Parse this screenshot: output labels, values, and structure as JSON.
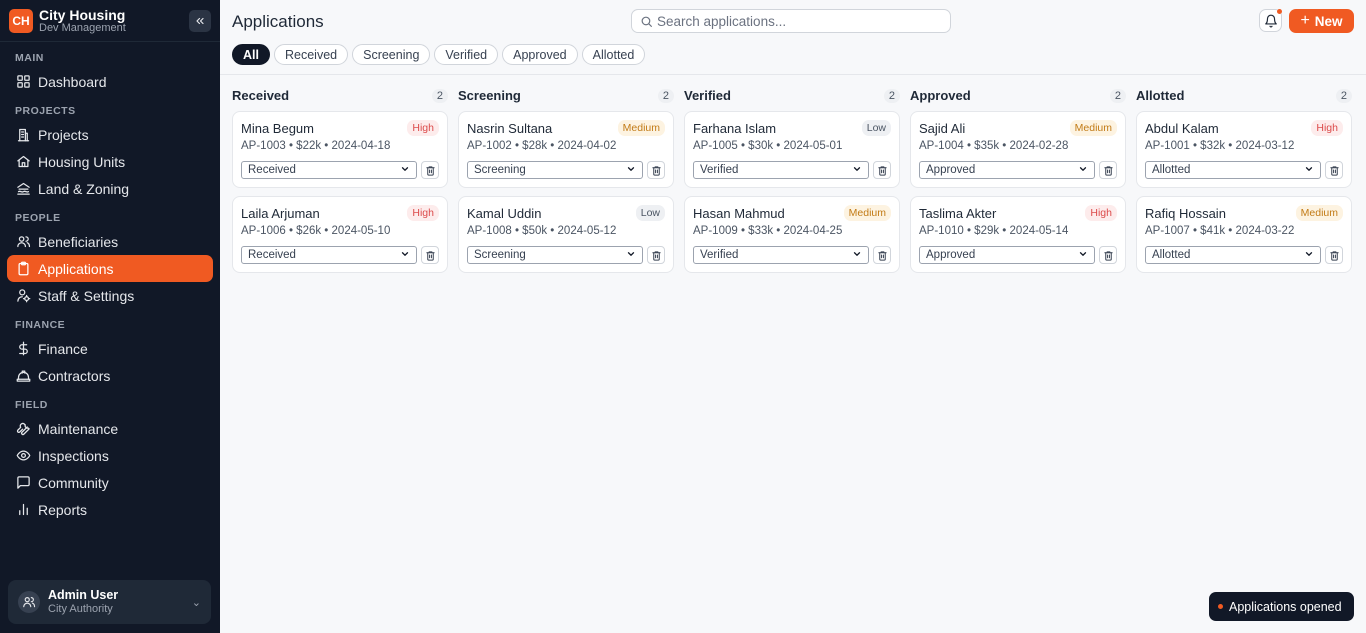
{
  "brand": {
    "logo": "CH",
    "title": "City Housing",
    "subtitle": "Dev Management",
    "collapse_icon": "chevrons-left-icon"
  },
  "sidebar": {
    "sections": [
      {
        "label": "MAIN",
        "items": [
          {
            "label": "Dashboard",
            "icon": "grid-icon"
          }
        ]
      },
      {
        "label": "PROJECTS",
        "items": [
          {
            "label": "Projects",
            "icon": "building-icon"
          },
          {
            "label": "Housing Units",
            "icon": "home-icon"
          },
          {
            "label": "Land & Zoning",
            "icon": "landmark-icon"
          }
        ]
      },
      {
        "label": "PEOPLE",
        "items": [
          {
            "label": "Beneficiaries",
            "icon": "users-icon"
          },
          {
            "label": "Applications",
            "icon": "clipboard-icon",
            "active": true
          },
          {
            "label": "Staff & Settings",
            "icon": "user-cog-icon"
          }
        ]
      },
      {
        "label": "FINANCE",
        "items": [
          {
            "label": "Finance",
            "icon": "dollar-icon"
          },
          {
            "label": "Contractors",
            "icon": "hardhat-icon"
          }
        ]
      },
      {
        "label": "FIELD",
        "items": [
          {
            "label": "Maintenance",
            "icon": "wrench-icon"
          },
          {
            "label": "Inspections",
            "icon": "eye-icon"
          },
          {
            "label": "Community",
            "icon": "message-icon"
          },
          {
            "label": "Reports",
            "icon": "bar-chart-icon"
          }
        ]
      }
    ]
  },
  "user": {
    "name": "Admin User",
    "role": "City Authority"
  },
  "header": {
    "title": "Applications",
    "search_placeholder": "Search applications...",
    "new_label": "New"
  },
  "filters": [
    "All",
    "Received",
    "Screening",
    "Verified",
    "Approved",
    "Allotted"
  ],
  "active_filter": "All",
  "columns": [
    {
      "title": "Received",
      "count": "2",
      "cards": [
        {
          "name": "Mina Begum",
          "priority": "High",
          "meta": "AP-1003 • $22k • 2024-04-18",
          "status": "Received"
        },
        {
          "name": "Laila Arjuman",
          "priority": "High",
          "meta": "AP-1006 • $26k • 2024-05-10",
          "status": "Received"
        }
      ]
    },
    {
      "title": "Screening",
      "count": "2",
      "cards": [
        {
          "name": "Nasrin Sultana",
          "priority": "Medium",
          "meta": "AP-1002 • $28k • 2024-04-02",
          "status": "Screening"
        },
        {
          "name": "Kamal Uddin",
          "priority": "Low",
          "meta": "AP-1008 • $50k • 2024-05-12",
          "status": "Screening"
        }
      ]
    },
    {
      "title": "Verified",
      "count": "2",
      "cards": [
        {
          "name": "Farhana Islam",
          "priority": "Low",
          "meta": "AP-1005 • $30k • 2024-05-01",
          "status": "Verified"
        },
        {
          "name": "Hasan Mahmud",
          "priority": "Medium",
          "meta": "AP-1009 • $33k • 2024-04-25",
          "status": "Verified"
        }
      ]
    },
    {
      "title": "Approved",
      "count": "2",
      "cards": [
        {
          "name": "Sajid Ali",
          "priority": "Medium",
          "meta": "AP-1004 • $35k • 2024-02-28",
          "status": "Approved"
        },
        {
          "name": "Taslima Akter",
          "priority": "High",
          "meta": "AP-1010 • $29k • 2024-05-14",
          "status": "Approved"
        }
      ]
    },
    {
      "title": "Allotted",
      "count": "2",
      "cards": [
        {
          "name": "Abdul Kalam",
          "priority": "High",
          "meta": "AP-1001 • $32k • 2024-03-12",
          "status": "Allotted"
        },
        {
          "name": "Rafiq Hossain",
          "priority": "Medium",
          "meta": "AP-1007 • $41k • 2024-03-22",
          "status": "Allotted"
        }
      ]
    }
  ],
  "toast": "Applications opened",
  "colors": {
    "accent": "#f05a22",
    "sidebar_bg": "#111827"
  }
}
